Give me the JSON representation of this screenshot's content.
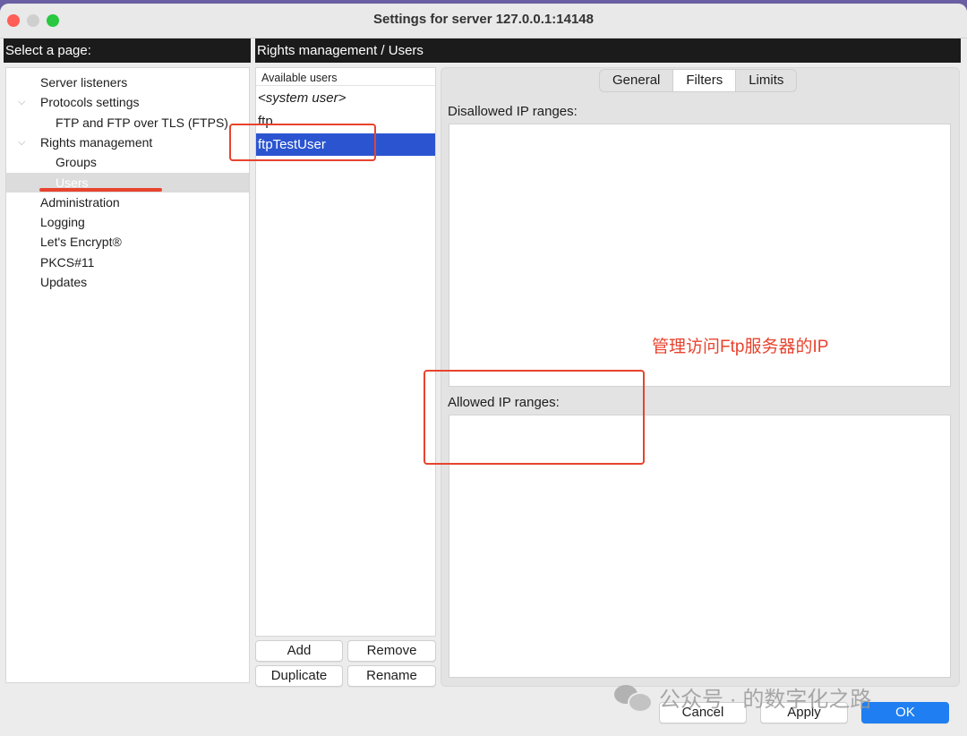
{
  "window": {
    "title": "Settings for server 127.0.0.1:14148"
  },
  "left_pane": {
    "header": "Select a page:",
    "tree": [
      {
        "label": "Server listeners",
        "depth": 1,
        "expanded": null,
        "selected": false
      },
      {
        "label": "Protocols settings",
        "depth": 1,
        "expanded": true,
        "selected": false
      },
      {
        "label": "FTP and FTP over TLS (FTPS)",
        "depth": 2,
        "expanded": null,
        "selected": false
      },
      {
        "label": "Rights management",
        "depth": 1,
        "expanded": true,
        "selected": false
      },
      {
        "label": "Groups",
        "depth": 2,
        "expanded": null,
        "selected": false
      },
      {
        "label": "Users",
        "depth": 2,
        "expanded": null,
        "selected": true
      },
      {
        "label": "Administration",
        "depth": 1,
        "expanded": null,
        "selected": false
      },
      {
        "label": "Logging",
        "depth": 1,
        "expanded": null,
        "selected": false
      },
      {
        "label": "Let's Encrypt®",
        "depth": 1,
        "expanded": null,
        "selected": false
      },
      {
        "label": "PKCS#11",
        "depth": 1,
        "expanded": null,
        "selected": false
      },
      {
        "label": "Updates",
        "depth": 1,
        "expanded": null,
        "selected": false
      }
    ]
  },
  "right_pane": {
    "header": "Rights management / Users",
    "users": {
      "heading": "Available users",
      "items": [
        {
          "label": "<system user>",
          "italic": true,
          "selected": false
        },
        {
          "label": "ftp",
          "italic": false,
          "selected": false
        },
        {
          "label": "ftpTestUser",
          "italic": false,
          "selected": true
        }
      ],
      "buttons": {
        "add": "Add",
        "remove": "Remove",
        "duplicate": "Duplicate",
        "rename": "Rename"
      }
    },
    "tabs": [
      {
        "label": "General",
        "active": false
      },
      {
        "label": "Filters",
        "active": true
      },
      {
        "label": "Limits",
        "active": false
      }
    ],
    "filters": {
      "disallowed_label": "Disallowed IP ranges:",
      "disallowed_value": "",
      "allowed_label": "Allowed IP ranges:",
      "allowed_value": ""
    }
  },
  "dialog_buttons": {
    "cancel": "Cancel",
    "apply": "Apply",
    "ok": "OK"
  },
  "annotations": {
    "note": "管理访问Ftp服务器的IP",
    "color": "#e8432e"
  },
  "watermark": {
    "text": "公众号 · 的数字化之路"
  },
  "colors": {
    "selection_blue": "#2b55d0",
    "ok_blue": "#1f7ff2",
    "header_black": "#1b1b1b"
  }
}
